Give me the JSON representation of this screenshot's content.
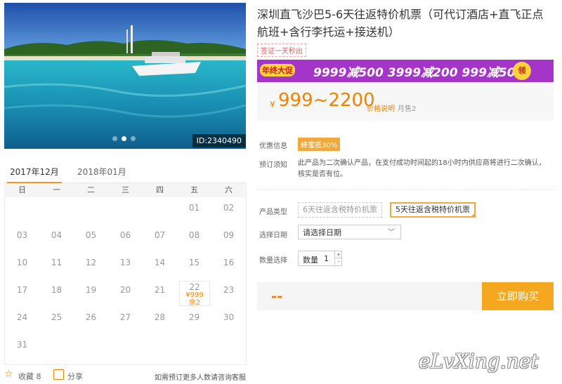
{
  "hero": {
    "id_badge": "ID:2340490",
    "dots": 3,
    "active_dot": 1
  },
  "calendar": {
    "months": [
      "2017年12月",
      "2018年01月"
    ],
    "active_month": 0,
    "weekdays": [
      "日",
      "一",
      "二",
      "三",
      "四",
      "五",
      "六"
    ],
    "rows": [
      [
        "",
        "",
        "",
        "",
        "",
        "01",
        "02"
      ],
      [
        "03",
        "04",
        "05",
        "06",
        "07",
        "08",
        "09"
      ],
      [
        "10",
        "11",
        "12",
        "13",
        "14",
        "15",
        "16"
      ],
      [
        "17",
        "18",
        "19",
        "20",
        "21",
        "22",
        "23"
      ],
      [
        "24",
        "25",
        "26",
        "27",
        "28",
        "29",
        "30"
      ],
      [
        "31",
        "",
        "",
        "",
        "",
        "",
        ""
      ]
    ],
    "highlight": {
      "day": "22",
      "price": "¥999",
      "remaining": "余2"
    }
  },
  "footer": {
    "favorite_label": "收藏 8",
    "share_label": "分享",
    "help_text": "如需预订更多人数请咨询客服"
  },
  "product": {
    "title": "深圳直飞沙巴5-6天往返特价机票（可代订酒店+直飞正点航班+含行李托运+接送机）",
    "verify_tag": "签证一天秒出",
    "banner": {
      "tag": "年终大促",
      "text": "9999减500  3999减200  999减50",
      "coin": "领"
    },
    "price": {
      "currency": "¥",
      "amount": "999~2200",
      "explain": "价格说明",
      "sold": "月售2"
    },
    "promo_label": "优惠信息",
    "promo_badge": "蜂蜜抵30%",
    "notice_label": "预订须知",
    "notice_text": "此产品为二次确认产品，在支付成功时间起的18小时内供应商将进行二次确认，核实是否有位。",
    "type_label": "产品类型",
    "type_options": [
      "6天往返含税特价机票",
      "5天往返含税特价机票"
    ],
    "selected_type": 1,
    "date_label": "选择日期",
    "date_placeholder": "请选择日期",
    "qty_label": "数量选择",
    "qty_inner_label": "数量",
    "qty_value": "1",
    "total_placeholder": "--",
    "buy_label": "立即购买"
  },
  "watermark": "eLvXing.net",
  "colors": {
    "accent": "#f08300",
    "button": "#f5a81f",
    "banner": "#a534c8"
  }
}
